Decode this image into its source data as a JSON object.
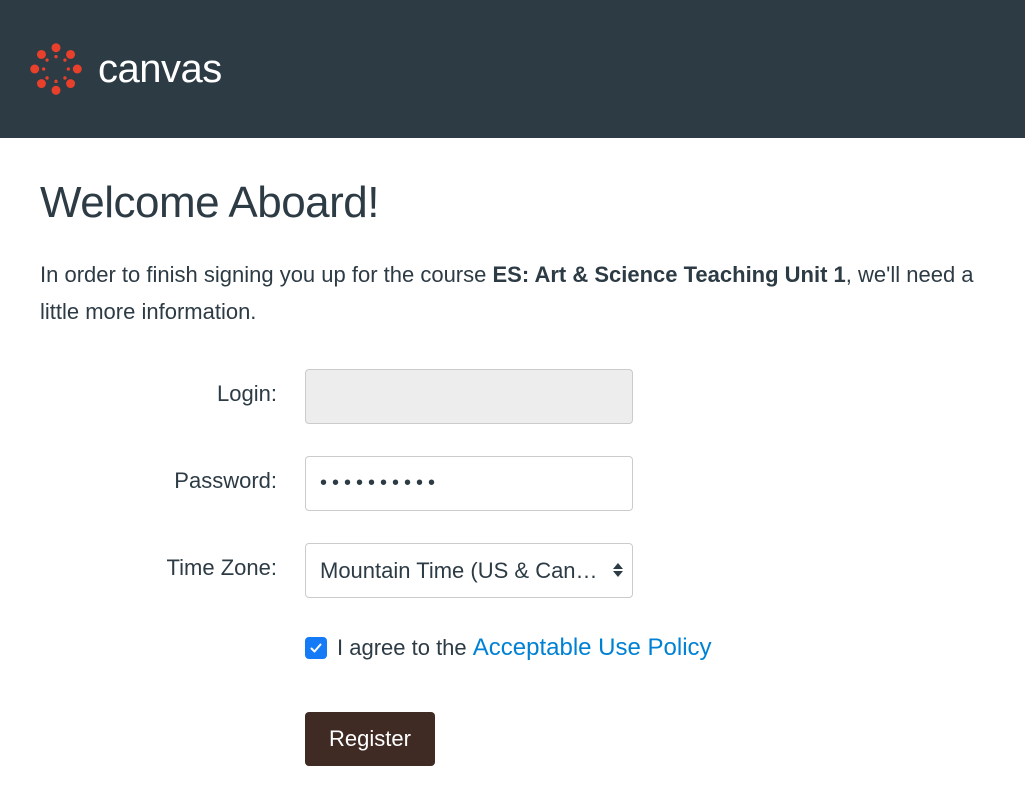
{
  "header": {
    "brand": "canvas"
  },
  "main": {
    "title": "Welcome Aboard!",
    "intro_prefix": "In order to finish signing you up for the course ",
    "course_name": "ES: Art & Science Teaching Unit 1",
    "intro_suffix": ", we'll need a little more information."
  },
  "form": {
    "login_label": "Login:",
    "login_value": "",
    "password_label": "Password:",
    "password_value": "••••••••••",
    "timezone_label": "Time Zone:",
    "timezone_value": "Mountain Time (US & Canada) (−",
    "terms_prefix": "I agree to the ",
    "terms_link": "Acceptable Use Policy",
    "terms_checked": true,
    "register_label": "Register"
  }
}
